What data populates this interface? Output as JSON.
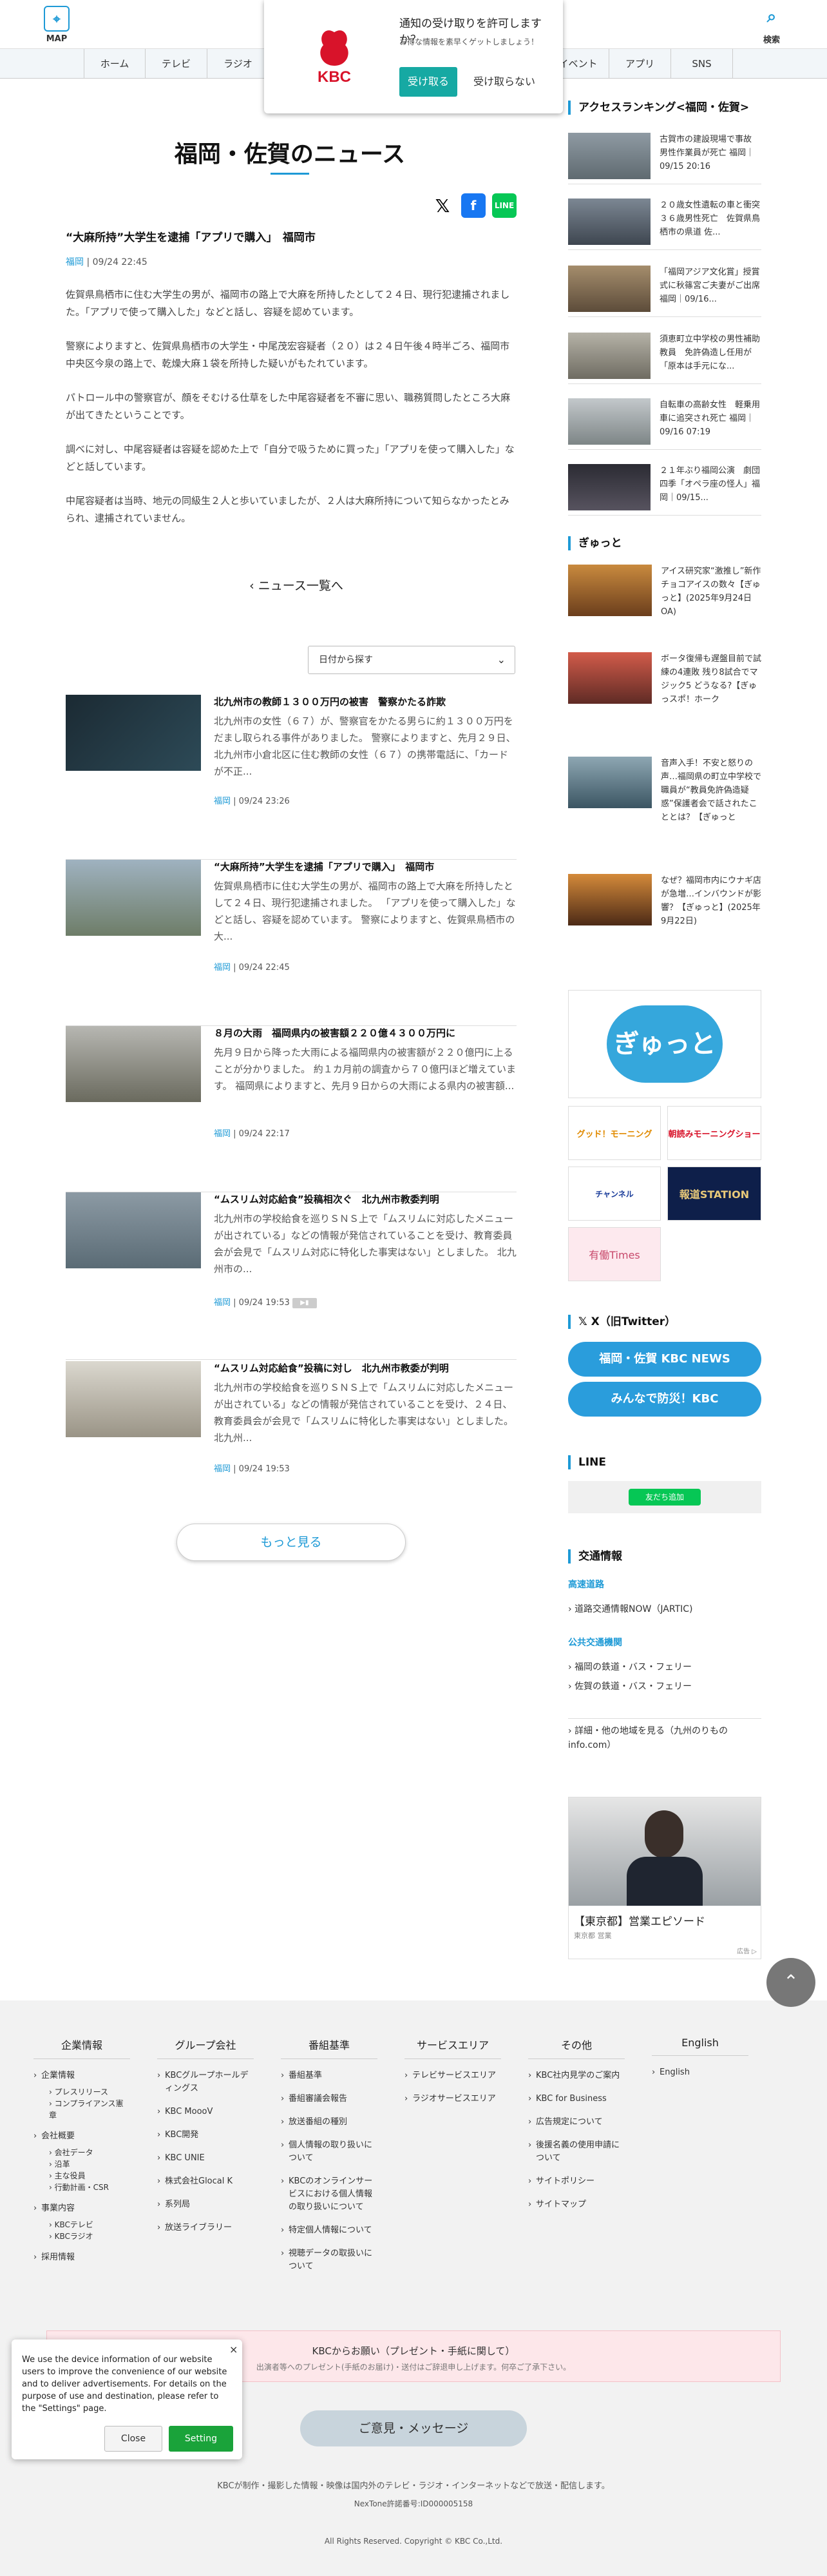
{
  "header": {
    "map_label": "MAP",
    "search_label": "検索",
    "nav": [
      "ホーム",
      "テレビ",
      "ラジオ",
      "",
      "",
      "",
      "",
      "",
      "イベント",
      "アプリ",
      "SNS"
    ]
  },
  "notification": {
    "title": "通知の受け取りを許可しますか？",
    "subtitle": "お得な情報を素早くゲットしましょう！",
    "accept": "受け取る",
    "decline": "受け取らない",
    "logo_text": "KBC"
  },
  "page": {
    "title": "福岡・佐賀のニュース"
  },
  "article": {
    "title": "“大麻所持”大学生を逮捕「アプリで購入」　福岡市",
    "category": "福岡",
    "date": "09/24 22:45",
    "paragraphs": [
      "佐賀県鳥栖市に住む大学生の男が、福岡市の路上で大麻を所持したとして２４日、現行犯逮捕されました。「アプリで使って購入した」などと話し、容疑を認めています。",
      "警察によりますと、佐賀県鳥栖市の大学生・中尾茂宏容疑者（２０）は２４日午後４時半ごろ、福岡市中央区今泉の路上で、乾燥大麻１袋を所持した疑いがもたれています。",
      "パトロール中の警察官が、顔をそむける仕草をした中尾容疑者を不審に思い、職務質問したところ大麻が出てきたということです。",
      "調べに対し、中尾容疑者は容疑を認めた上で「自分で吸うために買った」「アプリを使って購入した」などと話しています。",
      "中尾容疑者は当時、地元の同級生２人と歩いていましたが、２人は大麻所持について知らなかったとみられ、逮捕されていません。"
    ]
  },
  "back_label": "ニュース一覧へ",
  "date_select": "日付から探す",
  "news": [
    {
      "title": "北九州市の教師１３００万円の被害　警察かたる詐欺",
      "desc": "北九州市の女性（６７）が、警察官をかたる男らに約１３００万円をだまし取られる事件がありました。 警察によりますと、先月２９日、北九州市小倉北区に住む教師の女性（６７）の携帯電話に、「カードが不正...",
      "category": "福岡",
      "date": "09/24 23:26",
      "video": false
    },
    {
      "title": "“大麻所持”大学生を逮捕「アプリで購入」　福岡市",
      "desc": "佐賀県鳥栖市に住む大学生の男が、福岡市の路上で大麻を所持したとして２４日、現行犯逮捕されました。 「アプリを使って購入した」などと話し、容疑を認めています。 警察によりますと、佐賀県鳥栖市の大...",
      "category": "福岡",
      "date": "09/24 22:45",
      "video": false
    },
    {
      "title": "８月の大雨　福岡県内の被害額２２０億４３００万円に",
      "desc": "先月９日から降った大雨による福岡県内の被害額が２２０億円に上ることが分かりました。 約１カ月前の調査から７０億円ほど増えています。 福岡県によりますと、先月９日からの大雨による県内の被害額...",
      "category": "福岡",
      "date": "09/24 22:17",
      "video": false
    },
    {
      "title": "“ムスリム対応給食”投稿相次ぐ　北九州市教委判明",
      "desc": "北九州市の学校給食を巡りＳＮＳ上で「ムスリムに対応したメニューが出されている」などの情報が発信されていることを受け、教育委員会が会見で「ムスリム対応に特化した事実はない」としました。 北九州市の...",
      "category": "福岡",
      "date": "09/24 19:53",
      "video": true
    },
    {
      "title": "“ムスリム対応給食”投稿に対し　北九州市教委が判明",
      "desc": "北九州市の学校給食を巡りＳＮＳ上で「ムスリムに対応したメニューが出されている」などの情報が発信されていることを受け、２４日、教育委員会が会見で「ムスリムに特化した事実はない」としました。 北九州...",
      "category": "福岡",
      "date": "09/24 19:53",
      "video": false
    }
  ],
  "more_label": "もっと見る",
  "sidebar": {
    "ranking_head": "アクセスランキング<福岡・佐賀>",
    "ranking": [
      "古賀市の建設現場で事故 男性作業員が死亡 福岡｜09/15 20:16",
      "２０歳女性遺転の車と衝突　３６歳男性死亡　佐賀県鳥栖市の県道 佐...",
      "「福岡アジア文化賞」授賞式に秋篠宮ご夫妻がご出席 福岡｜09/16...",
      "須恵町立中学校の男性補助教員　免許偽造し任用が「原本は手元にな...",
      "自転車の高齢女性　軽乗用車に追突され死亡 福岡｜09/16 07:19",
      "２１年ぶり福岡公演　劇団四季「オペラ座の怪人」福岡｜09/15..."
    ],
    "gyutto_head": "ぎゅっと",
    "gyutto": [
      "アイス研究家“激推し”新作チョコアイスの数々【ぎゅっと】(2025年9月24日OA)",
      "ボータ復帰も遅盤目前で試練の4連敗 残り8試合でマジック5 どうなる?【ぎゅっスポ！ホーク",
      "音声入手！不安と怒りの声…福岡県の町立中学校で職員が“教員免許偽造疑惑”保護者会で話されたこととは？【ぎゅっと",
      "なぜ？福岡市内にウナギ店が急増…インバウンドが影響？【ぎゅっと】(2025年9月22日)"
    ],
    "banners": [
      "ぎゅっと",
      "グッド！モーニング",
      "朝読みモーニングショー",
      "チャンネル",
      "報道STATION",
      "有働Times"
    ],
    "x_head": "X（旧Twitter）",
    "x_buttons": [
      "福岡・佐賀 KBC NEWS",
      "みんなで防災！KBC"
    ],
    "line_head": "LINE",
    "line_button": "友だち追加",
    "traffic_head": "交通情報",
    "traffic_sub1": "高速道路",
    "traffic_l1": "道路交通情報NOW（JARTIC)",
    "traffic_sub2": "公共交通機関",
    "traffic_l2": "福岡の鉄道・バス・フェリー",
    "traffic_l3": "佐賀の鉄道・バス・フェリー",
    "traffic_l4": "詳細・他の地域を見る（九州のりものinfo.com）",
    "ad_title": "【東京都】営業エピソード",
    "ad_sub": "東京都 営業",
    "ad_mark": "広告"
  },
  "footer": {
    "cols": [
      {
        "head": "企業情報",
        "links": [
          {
            "t": "企業情報",
            "subs": [
              "プレスリリース",
              "コンプライアンス憲章"
            ]
          },
          {
            "t": "会社概要",
            "subs": [
              "会社データ",
              "沿革",
              "主な役員",
              "行動計画・CSR"
            ]
          },
          {
            "t": "事業内容",
            "subs": [
              "KBCテレビ",
              "KBCラジオ"
            ]
          },
          {
            "t": "採用情報",
            "subs": []
          }
        ]
      },
      {
        "head": "グループ会社",
        "links": [
          {
            "t": "KBCグループホールディングス",
            "subs": []
          },
          {
            "t": "KBC MoooV",
            "subs": []
          },
          {
            "t": "KBC開発",
            "subs": []
          },
          {
            "t": "KBC UNIE",
            "subs": []
          },
          {
            "t": "株式会社Glocal K",
            "subs": []
          },
          {
            "t": "系列局",
            "subs": []
          },
          {
            "t": "放送ライブラリー",
            "subs": []
          }
        ]
      },
      {
        "head": "番組基準",
        "links": [
          {
            "t": "番組基準",
            "subs": []
          },
          {
            "t": "番組審議会報告",
            "subs": []
          },
          {
            "t": "放送番組の種別",
            "subs": []
          },
          {
            "t": "個人情報の取り扱いについて",
            "subs": []
          },
          {
            "t": "KBCのオンラインサービスにおける個人情報の取り扱いについて",
            "subs": []
          },
          {
            "t": "特定個人情報について",
            "subs": []
          },
          {
            "t": "視聴データの取扱いについて",
            "subs": []
          }
        ]
      },
      {
        "head": "サービスエリア",
        "links": [
          {
            "t": "テレビサービスエリア",
            "subs": []
          },
          {
            "t": "ラジオサービスエリア",
            "subs": []
          }
        ]
      },
      {
        "head": "その他",
        "links": [
          {
            "t": "KBC社内見学のご案内",
            "subs": []
          },
          {
            "t": "KBC for Business",
            "subs": []
          },
          {
            "t": "広告規定について",
            "subs": []
          },
          {
            "t": "後援名義の使用申請について",
            "subs": []
          },
          {
            "t": "サイトポリシー",
            "subs": []
          },
          {
            "t": "サイトマップ",
            "subs": []
          }
        ]
      },
      {
        "head": "English",
        "links": [
          {
            "t": "English",
            "subs": []
          }
        ]
      }
    ],
    "request_title": "KBCからお願い（プレゼント・手紙に関して）",
    "request_text": "出演者等へのプレゼント(手紙のお届け)・送付はご辞退申し上げます。何卒ご了承下さい。",
    "opinion": "ご意見・メッセージ",
    "note1": "KBCが制作・撮影した情報・映像は国内外のテレビ・ラジオ・インターネットなどで放送・配信します。",
    "note2": "NexTone許諾番号:ID000005158",
    "copyright": "All Rights Reserved. Copyright © KBC Co.,Ltd."
  },
  "cookie": {
    "text": "We use the device information of our website users to improve the convenience of our website and to deliver advertisements. For details on the purpose of use and destination, please refer to the \"Settings\" page.",
    "close": "Close",
    "setting": "Setting"
  },
  "colors": {
    "accent": "#1e9ad6",
    "x_button": "#2a9ddc",
    "line_green": "#06c755",
    "accept": "#16a9a3",
    "kbc_red": "#d8132a"
  }
}
